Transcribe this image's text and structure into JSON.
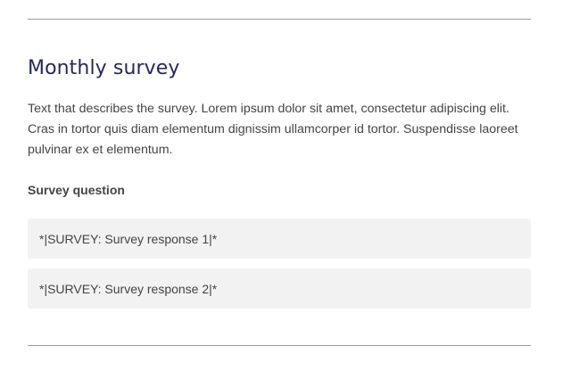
{
  "survey": {
    "title": "Monthly survey",
    "description": "Text that describes the survey. Lorem ipsum dolor sit amet, consectetur adipiscing elit. Cras in tortor quis diam elementum dignissim ullamcorper id tortor. Suspendisse laoreet pulvinar ex et elementum.",
    "question": "Survey question",
    "responses": [
      "*|SURVEY: Survey response 1|*",
      "*|SURVEY: Survey response 2|*"
    ]
  },
  "colors": {
    "title": "#25285a",
    "body_text": "#444444",
    "response_background": "#f2f2f2",
    "divider": "#999999"
  }
}
